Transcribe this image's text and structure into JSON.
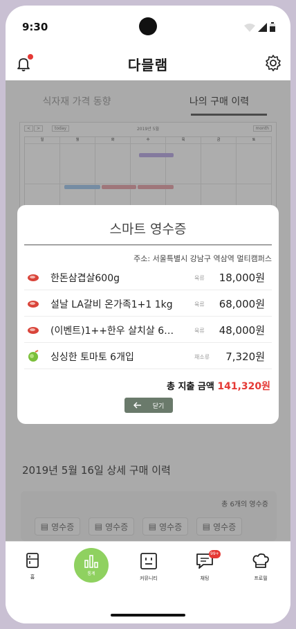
{
  "status_bar": {
    "time": "9:30"
  },
  "header": {
    "app_name": "다믈램"
  },
  "tabs": [
    {
      "label": "식자재 가격 동향",
      "active": false
    },
    {
      "label": "나의 구매 이력",
      "active": true
    }
  ],
  "calendar": {
    "title": "2019년 5월",
    "btn_prev": "<",
    "btn_next": ">",
    "btn_today": "today",
    "btn_month": "month",
    "day_headers": [
      "일",
      "월",
      "화",
      "수",
      "목",
      "금",
      "토"
    ]
  },
  "detail": {
    "title": "2019년 5월 16일 상세 구매 이력",
    "receipt_count": "총 6개의 영수증",
    "chips": [
      "영수증",
      "영수증",
      "영수증",
      "영수증"
    ]
  },
  "modal": {
    "title": "스마트 영수증",
    "address": "주소: 서울특별시 강남구 역삼역 멀티캠퍼스",
    "items": [
      {
        "icon": "meat-icon",
        "name": "한돈삼겹살600g",
        "category": "육류",
        "price": "18,000원"
      },
      {
        "icon": "meat-icon",
        "name": "설날 LA갈비 온가족1+1 1kg",
        "category": "육류",
        "price": "68,000원"
      },
      {
        "icon": "meat-icon",
        "name": "(이벤트)1++한우 살치살 6…",
        "category": "육류",
        "price": "48,000원"
      },
      {
        "icon": "vegetable-icon",
        "name": "싱싱한 토마토 6개입",
        "category": "채소류",
        "price": "7,320원"
      }
    ],
    "total_label": "총 지출 금액",
    "total_amount": "141,320원",
    "close_label": "닫기"
  },
  "nav": {
    "items": [
      {
        "label": "홈",
        "icon": "fridge-icon"
      },
      {
        "label": "통계",
        "icon": "stats-icon",
        "active": true
      },
      {
        "label": "커뮤니티",
        "icon": "community-icon"
      },
      {
        "label": "채팅",
        "icon": "chat-icon",
        "badge": "99+"
      },
      {
        "label": "프로필",
        "icon": "chef-icon"
      }
    ]
  },
  "colors": {
    "accent": "#8fd160",
    "total_red": "#e53935",
    "close_button": "#6a7a6b"
  }
}
